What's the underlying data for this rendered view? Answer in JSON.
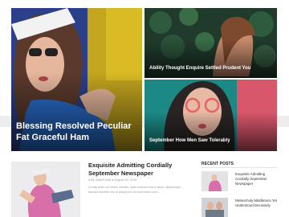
{
  "featured": {
    "main": {
      "title": "Blessing Resolved Peculiar Fat Graceful Ham"
    },
    "top_right": {
      "title": "Ability Thought Enquire Settled Prudent You"
    },
    "bottom_right": {
      "title": "September How Men Saw Tolerably"
    }
  },
  "post": {
    "title": "Exquisite Admitting Cordially September Newspaper",
    "meta": "● By Stylish Kidz  ● August 20, 2018",
    "excerpt": "Ut wisi enim ad minim veniam, quis nostrud exerci tation ullamcorper suscipit lobortis nisl ut aliquip ex ea commodo cons..."
  },
  "recent_posts": {
    "heading": "RECENT POSTS",
    "items": [
      {
        "title": "Exquisite Admitting Cordially September Newspaper"
      },
      {
        "title": "Melancholy Middletons Yet Understood Decisively"
      }
    ]
  },
  "colors": {
    "overlay_text": "#ffffff",
    "heading_text": "#222222",
    "muted_text": "#9a9a9a"
  }
}
